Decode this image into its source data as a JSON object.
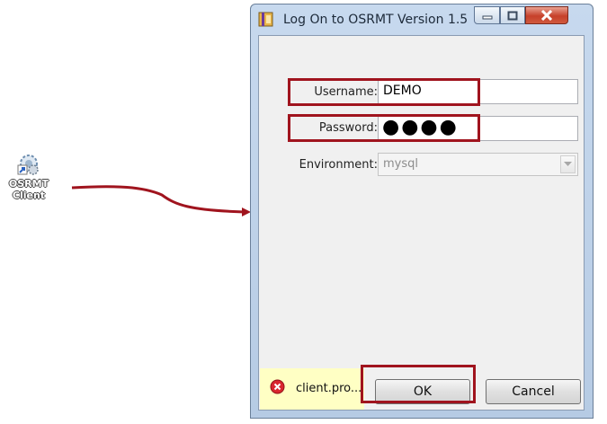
{
  "desktop": {
    "shortcut_label_line1": "OSRMT",
    "shortcut_label_line2": "Client",
    "shortcut_icon": "gear-shortcut-icon"
  },
  "dialog": {
    "title": "Log On to OSRMT Version 1.5",
    "window_buttons": [
      "minimize-icon",
      "maximize-icon",
      "close-icon"
    ],
    "fields": {
      "username": {
        "label": "Username:",
        "value": "DEMO"
      },
      "password": {
        "label": "Password:",
        "value": "●●●●"
      },
      "environment": {
        "label": "Environment:",
        "value": "mysql",
        "enabled": false
      }
    },
    "status": {
      "icon": "error-icon",
      "text": "client.pro..."
    },
    "buttons": {
      "ok": "OK",
      "cancel": "Cancel"
    }
  },
  "annotation": {
    "highlight_color": "#a0141e",
    "arrow_color": "#a0141e"
  }
}
